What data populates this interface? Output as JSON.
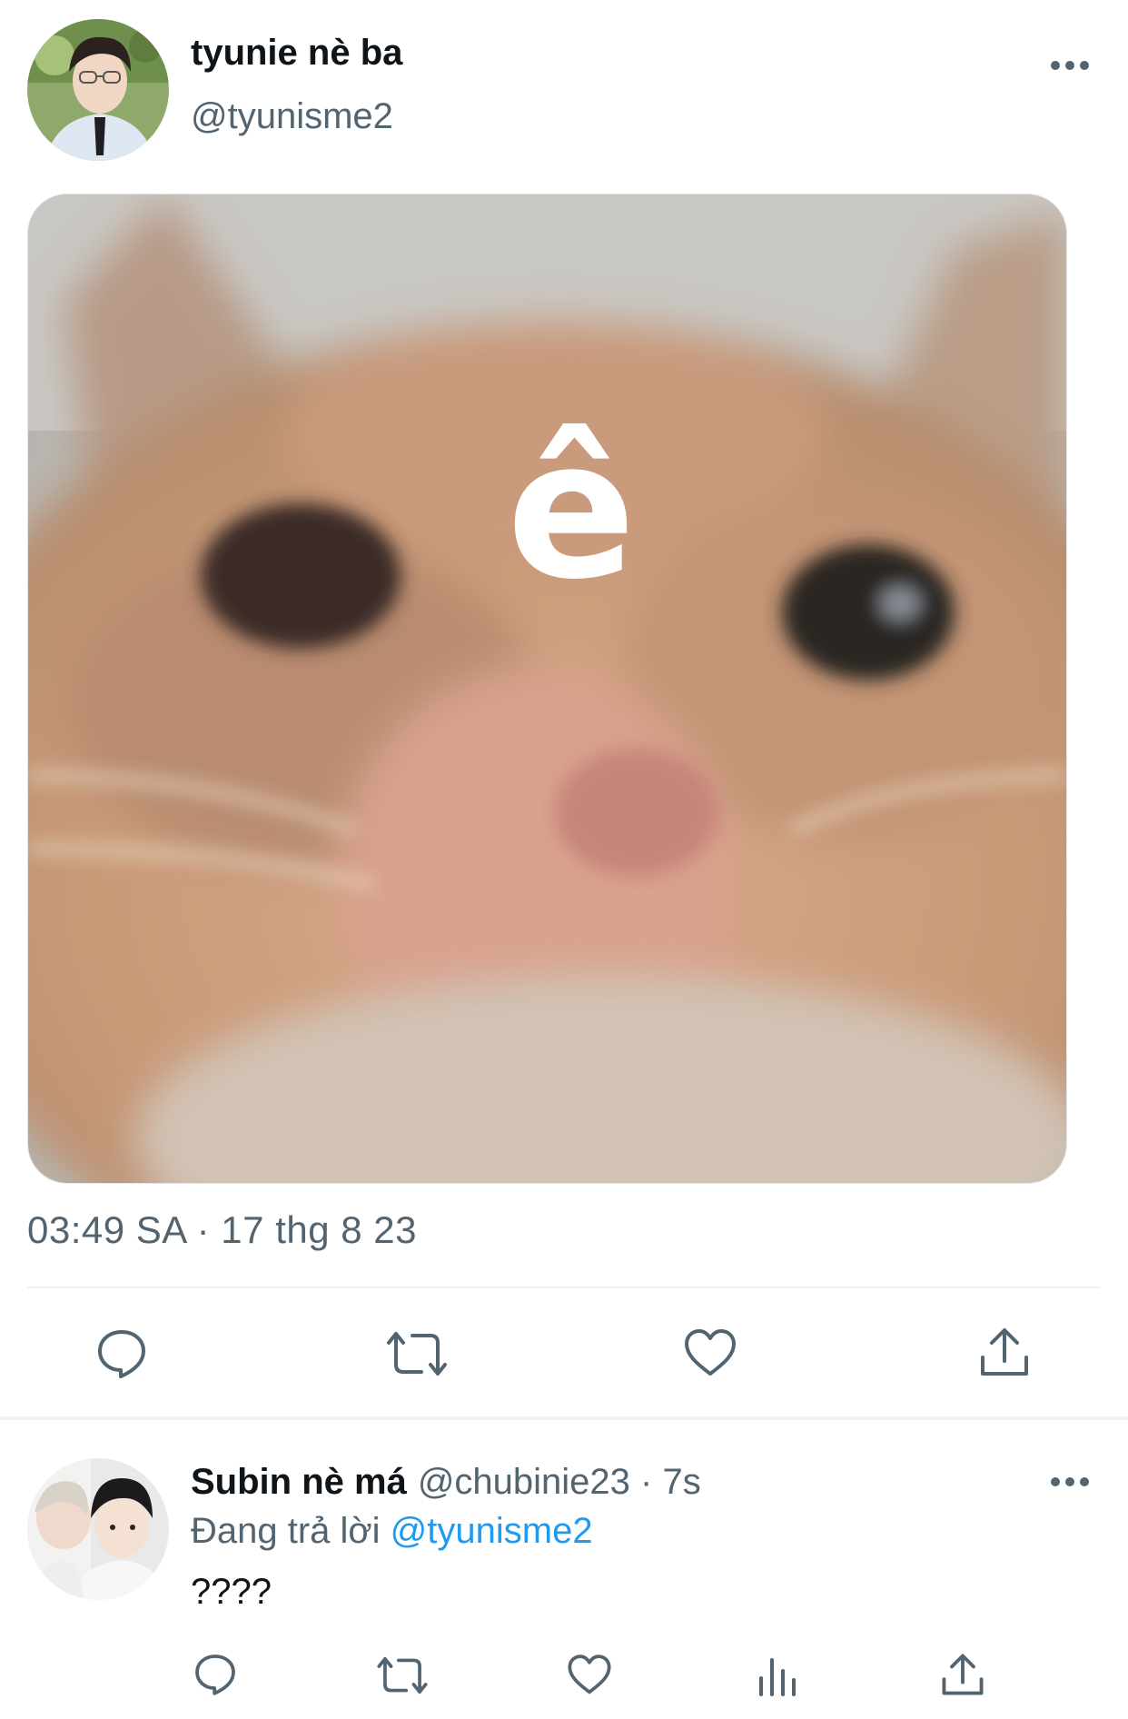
{
  "main_tweet": {
    "author": {
      "display_name": "tyunie nè ba",
      "handle": "@tyunisme2"
    },
    "media_text": "ê",
    "timestamp": "03:49 SA · 17 thg 8 23",
    "actions": [
      "reply-icon",
      "retweet-icon",
      "like-icon",
      "share-icon"
    ]
  },
  "reply_tweet": {
    "author": {
      "display_name": "Subin nè má",
      "handle_time": "@chubinie23 · 7s"
    },
    "replying_prefix": "Đang trả lời",
    "replying_mention": "@tyunisme2",
    "text": "????",
    "actions": [
      "reply-icon",
      "retweet-icon",
      "like-icon",
      "analytics-icon",
      "share-icon"
    ]
  },
  "colors": {
    "text_primary": "#0f1419",
    "text_secondary": "#536471",
    "accent": "#1d9bf0",
    "divider": "#eff3f4"
  }
}
